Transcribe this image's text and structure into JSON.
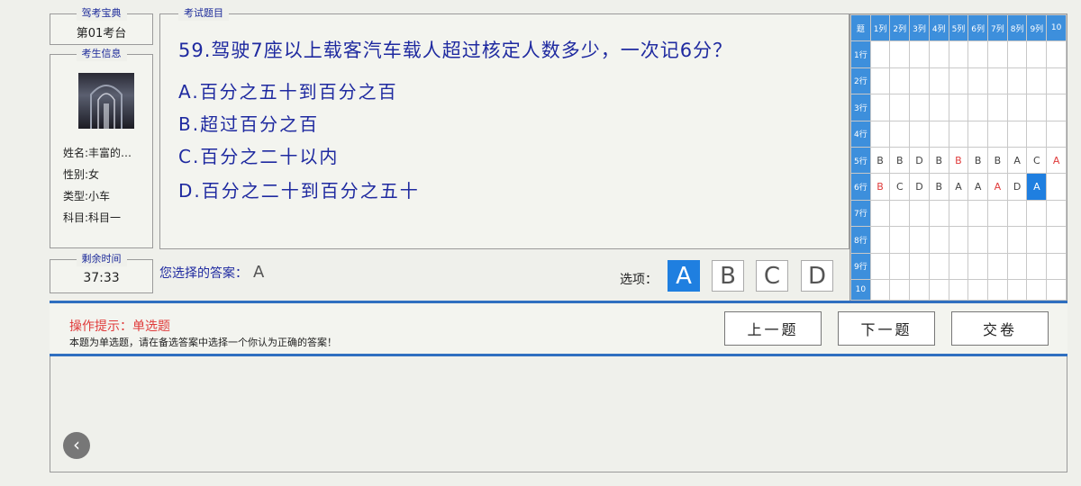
{
  "header": {
    "app_title": "驾考宝典",
    "exam_seat": "第01考台"
  },
  "candidate": {
    "section_title": "考生信息",
    "name": "姓名:丰富的…",
    "gender": "性别:女",
    "type": "类型:小车",
    "subject": "科目:科目一"
  },
  "timer": {
    "section_title": "剩余时间",
    "value": "37:33"
  },
  "question": {
    "section_title": "考试题目",
    "text": "59.驾驶7座以上载客汽车载人超过核定人数多少，一次记6分？",
    "options": [
      "A.百分之五十到百分之百",
      "B.超过百分之百",
      "C.百分之二十以内",
      "D.百分之二十到百分之五十"
    ]
  },
  "answer": {
    "your_answer_label": "您选择的答案：",
    "your_answer_value": "A",
    "options_label": "选项：",
    "buttons": [
      "A",
      "B",
      "C",
      "D"
    ],
    "selected": "A"
  },
  "grid": {
    "corner_label": "题",
    "columns": [
      "1列",
      "2列",
      "3列",
      "4列",
      "5列",
      "6列",
      "7列",
      "8列",
      "9列",
      "10"
    ],
    "rows": [
      "1行",
      "2行",
      "3行",
      "4行",
      "5行",
      "6行",
      "7行",
      "8行",
      "9行",
      "10"
    ],
    "row5": [
      "B",
      "B",
      "D",
      "B",
      "B",
      "B",
      "B",
      "A",
      "C",
      "A"
    ],
    "row6": [
      "B",
      "C",
      "D",
      "B",
      "A",
      "A",
      "A",
      "D",
      "A",
      ""
    ],
    "colors": {
      "header": "#3d8fdc",
      "wrong": "#e03b3b",
      "current": "#1f7fe0"
    }
  },
  "tips": {
    "title": "操作提示：单选题",
    "description": "本题为单选题，请在备选答案中选择一个你认为正确的答案！"
  },
  "nav": {
    "prev": "上一题",
    "next": "下一题",
    "submit": "交卷"
  },
  "icons": {
    "back": "chevron-left-icon"
  }
}
